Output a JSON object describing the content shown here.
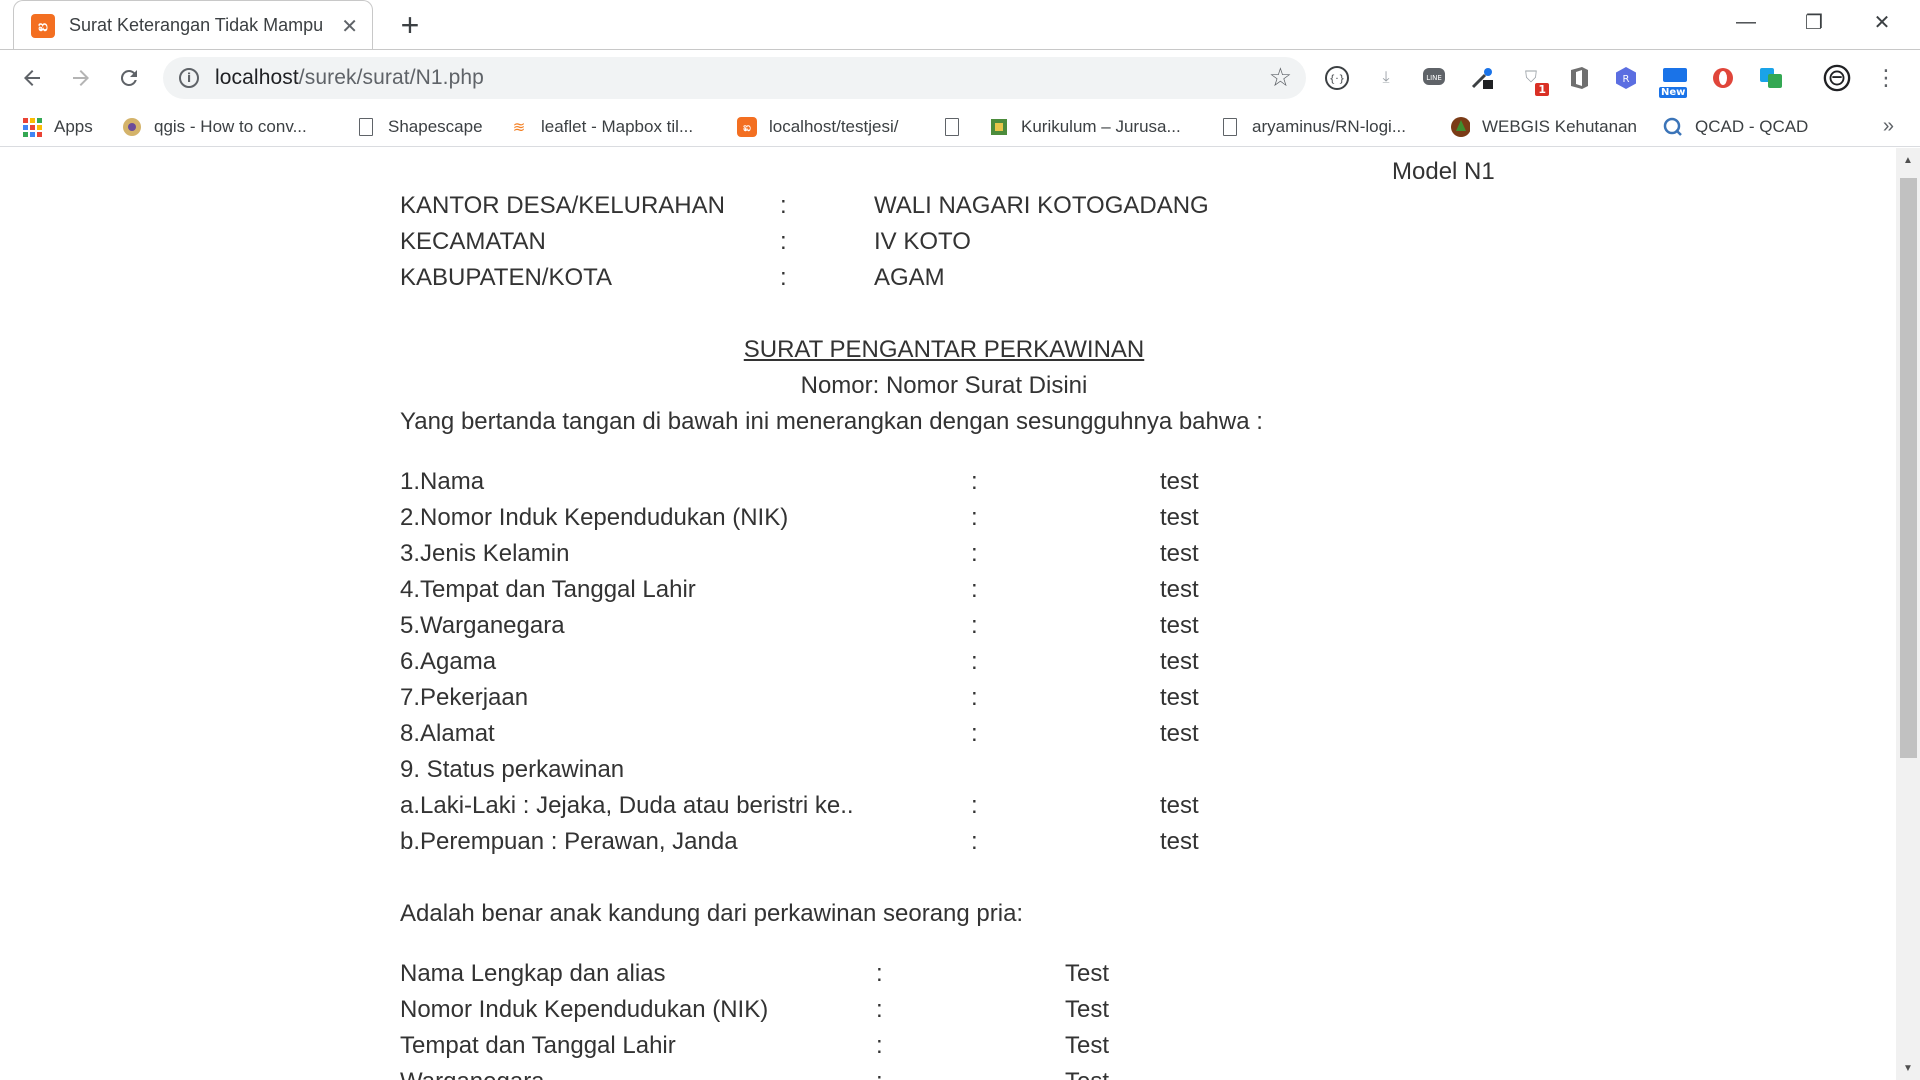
{
  "browser": {
    "tab_title": "Surat Keterangan Tidak Mampu",
    "url_host": "localhost",
    "url_path": "/surek/surat/N1.php",
    "bookmarks": [
      {
        "label": "Apps",
        "icon": "apps-grid-icon"
      },
      {
        "label": "qgis - How to conv...",
        "icon": "gis-icon"
      },
      {
        "label": "Shapescape",
        "icon": "page-icon"
      },
      {
        "label": "leaflet - Mapbox til...",
        "icon": "stackoverflow-icon"
      },
      {
        "label": "localhost/testjesi/",
        "icon": "xampp-icon"
      },
      {
        "label": "",
        "icon": "page-icon"
      },
      {
        "label": "Kurikulum – Jurusa...",
        "icon": "university-icon"
      },
      {
        "label": "aryaminus/RN-logi...",
        "icon": "page-icon"
      },
      {
        "label": "WEBGIS Kehutanan",
        "icon": "forestry-icon"
      },
      {
        "label": "QCAD - QCAD",
        "icon": "qcad-icon"
      }
    ],
    "ext_badge": "1",
    "ext_new": "New"
  },
  "doc": {
    "model": "Model N1",
    "header": [
      {
        "label": "KANTOR DESA/KELURAHAN",
        "colon": ":",
        "value": "WALI NAGARI KOTOGADANG"
      },
      {
        "label": "KECAMATAN",
        "colon": ":",
        "value": "IV KOTO"
      },
      {
        "label": "KABUPATEN/KOTA",
        "colon": ":",
        "value": "AGAM"
      }
    ],
    "title": "SURAT PENGANTAR PERKAWINAN",
    "nomor": "Nomor: Nomor Surat Disini",
    "intro": "Yang bertanda tangan di bawah ini menerangkan dengan sesungguhnya bahwa :",
    "fields": [
      {
        "label": "1.Nama",
        "colon": ":",
        "value": "test"
      },
      {
        "label": "2.Nomor Induk Kependudukan (NIK)",
        "colon": ":",
        "value": "test"
      },
      {
        "label": "3.Jenis Kelamin",
        "colon": ":",
        "value": "test"
      },
      {
        "label": "4.Tempat dan Tanggal Lahir",
        "colon": ":",
        "value": "test"
      },
      {
        "label": "5.Warganegara",
        "colon": ":",
        "value": "test"
      },
      {
        "label": "6.Agama",
        "colon": ":",
        "value": "test"
      },
      {
        "label": "7.Pekerjaan",
        "colon": ":",
        "value": "test"
      },
      {
        "label": "8.Alamat",
        "colon": ":",
        "value": "test"
      },
      {
        "label": "9. Status perkawinan",
        "colon": "",
        "value": ""
      },
      {
        "label": "a.Laki-Laki : Jejaka, Duda atau beristri ke..",
        "colon": ":",
        "value": "test"
      },
      {
        "label": "b.Perempuan : Perawan, Janda",
        "colon": ":",
        "value": "test"
      }
    ],
    "father_intro": "Adalah benar anak kandung dari perkawinan seorang pria:",
    "father_fields": [
      {
        "label": "Nama Lengkap dan alias",
        "colon": ":",
        "value": "Test"
      },
      {
        "label": "Nomor Induk Kependudukan (NIK)",
        "colon": ":",
        "value": "Test"
      },
      {
        "label": "Tempat dan Tanggal Lahir",
        "colon": ":",
        "value": "Test"
      },
      {
        "label": "Warganegara",
        "colon": ":",
        "value": "Test"
      }
    ]
  }
}
